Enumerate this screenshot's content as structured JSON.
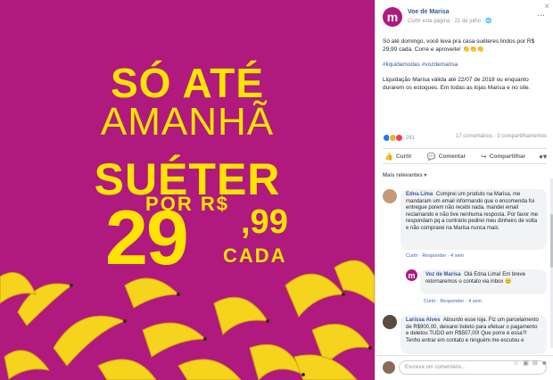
{
  "promo": {
    "line1": "SÓ ATÉ",
    "line2": "AMANHÃ",
    "line3": "SUÉTER",
    "line4": "POR R$",
    "price_int": "29",
    "price_cents": ",99",
    "price_unit": "CADA",
    "colors": {
      "background": "#b0197d",
      "text": "#ffe400"
    }
  },
  "post": {
    "close_icon": "×",
    "page_avatar_letter": "m",
    "page_name": "Voe de Marisa",
    "meta": "Curtir esta página · 21 de julho · 🌐",
    "more_icon": "···",
    "text1": "Só até domingo, você leva pra casa suéteres lindos por R$ 29,99 cada. Corre e aproveite! 👏👏👏",
    "hashtags": "#liquidamodas #vozdemarisa",
    "text2": "Liquidação Marisa válida até 22/07 de 2018 ou enquanto durarem os estoques. Em todas as lojas Marisa e no site.",
    "reaction_count": "281",
    "comments_shares": "17 comentários · 3 compartilhamentos",
    "actions": {
      "like": "Curtir",
      "comment": "Comentar",
      "share": "Compartilhar"
    },
    "sort_label": "Mais relevantes ▾"
  },
  "comments": [
    {
      "author": "Edna Lima",
      "text": "Comprei um produto na Marisa, me mandaram um email informando que o encomenda foi entregue porem não recebi nada. mandei email reclamando e não tive nenhuma resposta. Por favor me respondam pq a contrário pedirei meu dinheiro de volta e não comprarei na Marisa nunca mais",
      "links": "Curtir · Responder · 4 sem"
    },
    {
      "author": "Voz de Marisa",
      "avatar_letter": "m",
      "text": "Olá Edna Lima! Em breve retornaremos o contato via inbox 😊",
      "links": "Curtir · Responder · 4 sem"
    },
    {
      "author": "Larissa Alves",
      "text": "Absurdo esse loja. Fiz um parcelamento de R$900,00, deixarei boleto para efetuar o pagamento e deletou TUDO em R$507,00! Que porre é essa?! Tenho entrar em contato e ninguém me escutou e"
    }
  ],
  "composer": {
    "placeholder": "Escreva um comentário...",
    "tools": "☺ ▣ ⊞ ☻"
  }
}
